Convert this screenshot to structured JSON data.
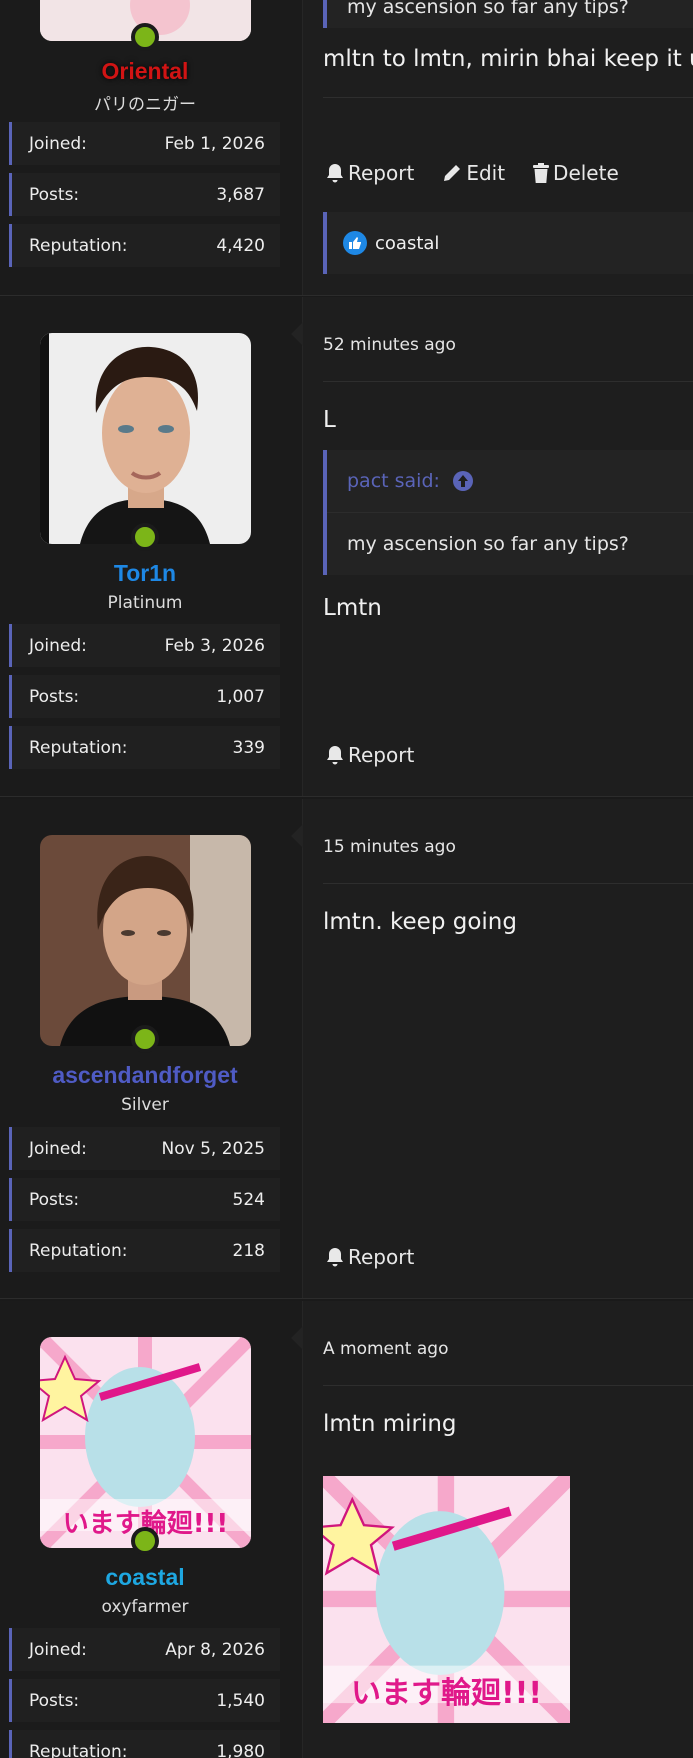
{
  "posts": [
    {
      "username": "Oriental",
      "user_title": "パリのニガー",
      "stats": {
        "joined_label": "Joined:",
        "joined": "Feb 1, 2026",
        "posts_label": "Posts:",
        "posts": "3,687",
        "rep_label": "Reputation:",
        "reputation": "4,420"
      },
      "quote_tail": "my ascension so far any tips?",
      "body": "mltn to lmtn, mirin bhai keep it up",
      "actions": {
        "report": "Report",
        "edit": "Edit",
        "delete": "Delete"
      },
      "reaction_user": "coastal"
    },
    {
      "username": "Tor1n",
      "user_title": "Platinum",
      "stats": {
        "joined_label": "Joined:",
        "joined": "Feb 3, 2026",
        "posts_label": "Posts:",
        "posts": "1,007",
        "rep_label": "Reputation:",
        "reputation": "339"
      },
      "time": "52 minutes ago",
      "body_top": "L",
      "quote_author": "pact said:",
      "quote_text": "my ascension so far any tips?",
      "body": "Lmtn",
      "actions": {
        "report": "Report"
      }
    },
    {
      "username": "ascendandforget",
      "user_title": "Silver",
      "stats": {
        "joined_label": "Joined:",
        "joined": "Nov 5, 2025",
        "posts_label": "Posts:",
        "posts": "524",
        "rep_label": "Reputation:",
        "reputation": "218"
      },
      "time": "15 minutes ago",
      "body": "lmtn. keep going",
      "actions": {
        "report": "Report"
      }
    },
    {
      "username": "coastal",
      "user_title": "oxyfarmer",
      "stats": {
        "joined_label": "Joined:",
        "joined": "Apr 8, 2026",
        "posts_label": "Posts:",
        "posts": "1,540",
        "rep_label": "Reputation:",
        "reputation": "1,980"
      },
      "time": "A moment ago",
      "body": "lmtn miring",
      "avatar_caption": "います輪廻!!!"
    }
  ],
  "colors": {
    "accent": "#5a64b8",
    "online": "#7cb518",
    "username_tor1n": "#1e88e5",
    "username_ascend": "#4f5bc4",
    "username_coastal": "#1ea7e1",
    "username_oriental": "#d11414"
  },
  "icons": {
    "report": "bell-icon",
    "edit": "pencil-icon",
    "delete": "trash-icon",
    "quote_jump": "arrow-up-circle-icon",
    "reaction": "thumbs-up-icon"
  }
}
